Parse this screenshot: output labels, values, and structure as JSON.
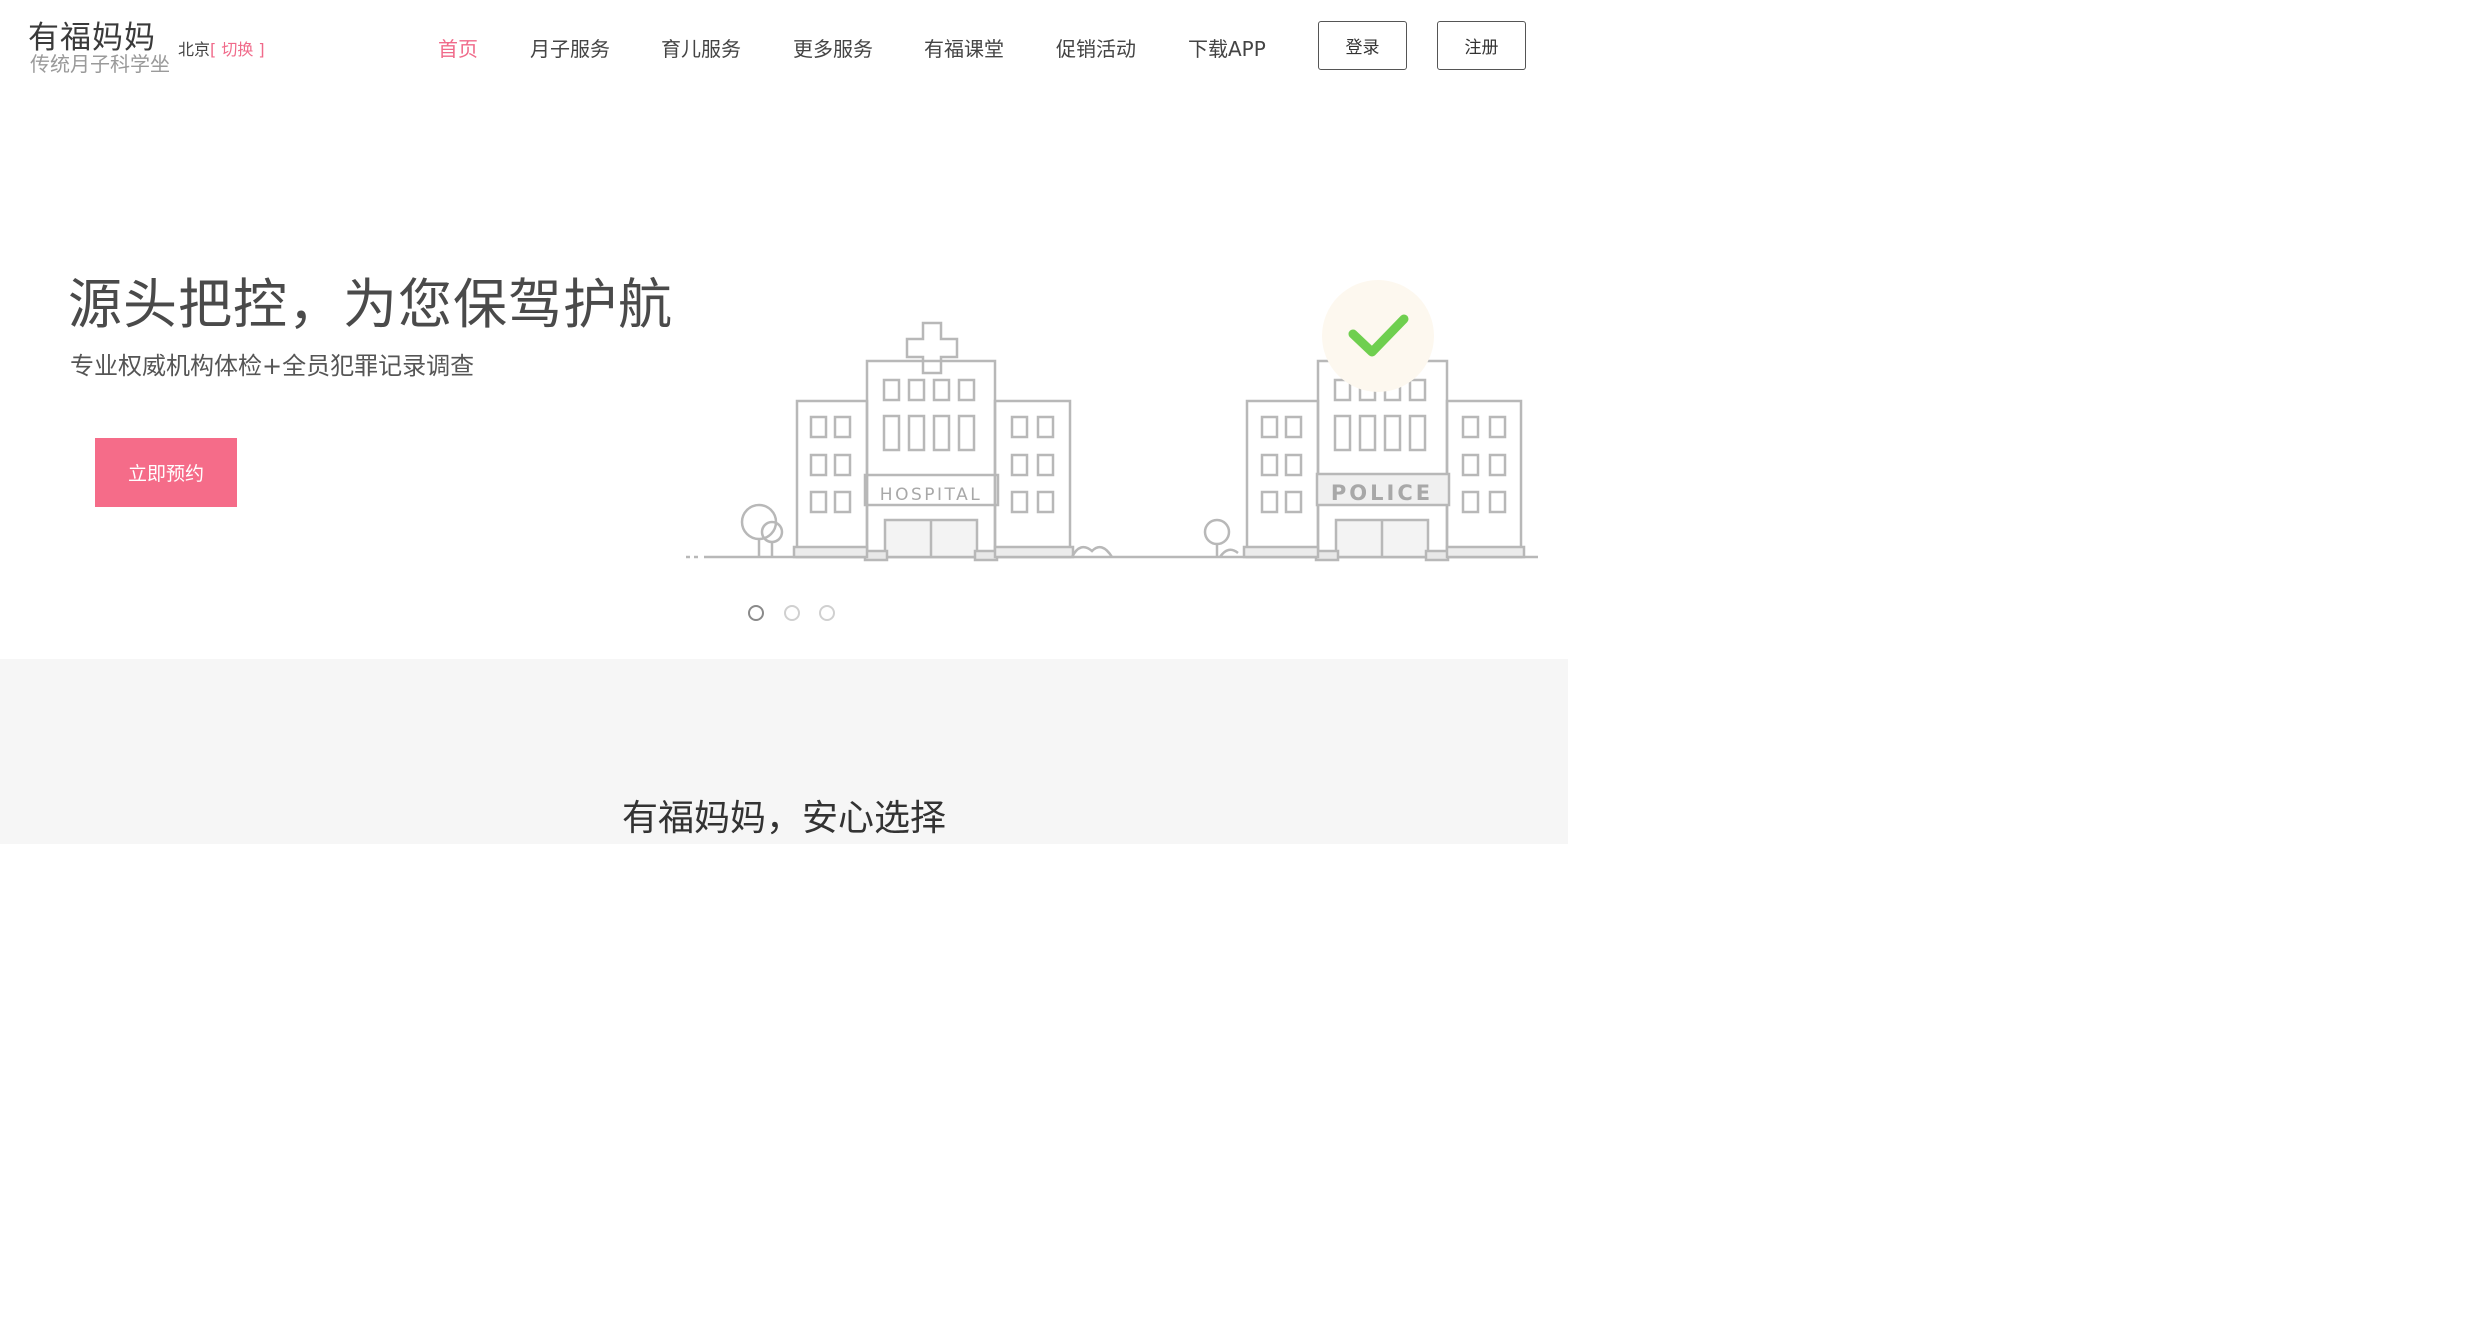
{
  "logo": {
    "main": "有福妈妈",
    "sub": "传统月子科学坐"
  },
  "city": {
    "name": "北京",
    "switch_label": "[ 切换 ]"
  },
  "nav": {
    "items": [
      {
        "label": "首页",
        "active": true
      },
      {
        "label": "月子服务"
      },
      {
        "label": "育儿服务"
      },
      {
        "label": "更多服务"
      },
      {
        "label": "有福课堂"
      },
      {
        "label": "促销活动"
      },
      {
        "label": "下载APP"
      }
    ],
    "active_color": "#f06a8a"
  },
  "auth": {
    "login_label": "登录",
    "register_label": "注册"
  },
  "hero": {
    "title": "源头把控，为您保驾护航",
    "subtitle": "专业权威机构体检+全员犯罪记录调查",
    "cta_label": "立即预约",
    "cta_color": "#f56c89",
    "hospital_sign": "HOSPITAL",
    "police_sign": "POLICE",
    "check_color": "#6fcf4f",
    "slide_count": 3,
    "active_slide": 1
  },
  "section": {
    "title": "有福妈妈，安心选择"
  }
}
